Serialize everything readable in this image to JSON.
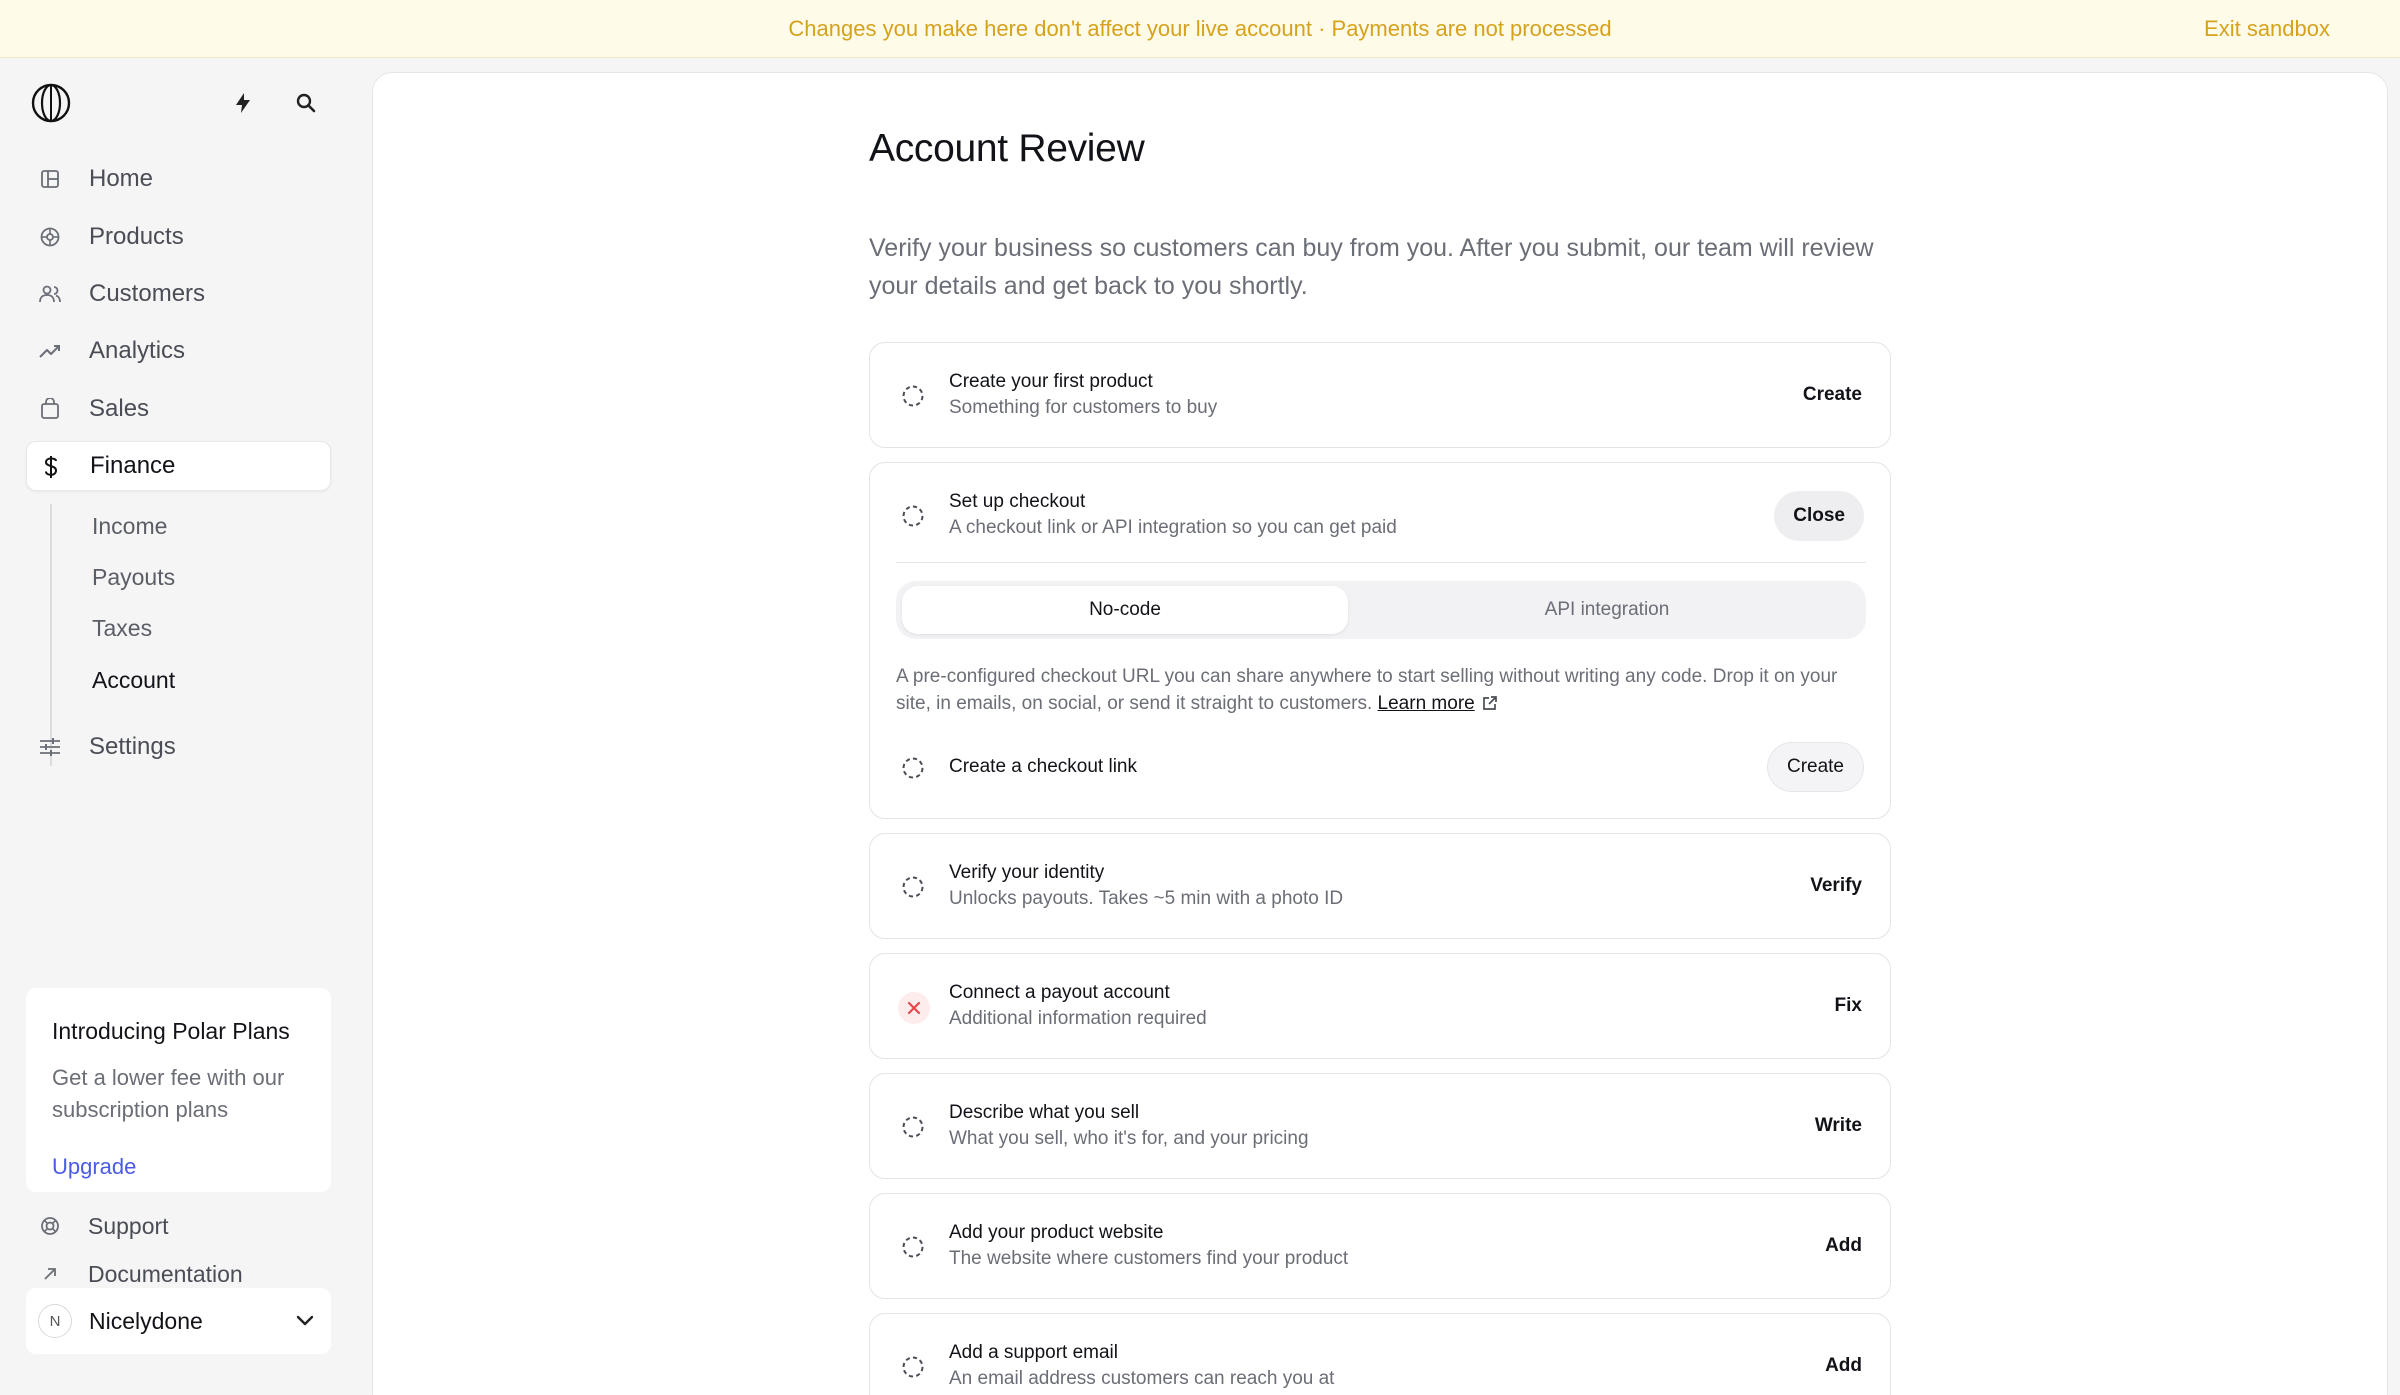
{
  "banner": {
    "text": "Changes you make here don't affect your live account · Payments are not processed",
    "exit_label": "Exit sandbox"
  },
  "sidebar": {
    "items": [
      {
        "label": "Home",
        "icon": "home-icon"
      },
      {
        "label": "Products",
        "icon": "products-icon"
      },
      {
        "label": "Customers",
        "icon": "customers-icon"
      },
      {
        "label": "Analytics",
        "icon": "analytics-icon"
      },
      {
        "label": "Sales",
        "icon": "sales-icon"
      },
      {
        "label": "Finance",
        "icon": "dollar-icon",
        "active": true
      }
    ],
    "finance_sub": [
      "Income",
      "Payouts",
      "Taxes",
      "Account"
    ],
    "finance_sub_active": "Account",
    "settings_label": "Settings",
    "promo": {
      "title": "Introducing Polar Plans",
      "text": "Get a lower fee with our subscription plans",
      "link": "Upgrade"
    },
    "support_label": "Support",
    "docs_label": "Documentation",
    "user": {
      "initial": "N",
      "name": "Nicelydone"
    }
  },
  "main": {
    "title": "Account Review",
    "description": "Verify your business so customers can buy from you. After you submit, our team will review your details and get back to you shortly.",
    "steps": [
      {
        "title": "Create your first product",
        "sub": "Something for customers to buy",
        "action": "Create",
        "status": "pending"
      },
      {
        "title": "Set up checkout",
        "sub": "A checkout link or API integration so you can get paid",
        "action": "Close",
        "status": "pending",
        "expanded": true
      },
      {
        "title": "Verify your identity",
        "sub": "Unlocks payouts. Takes ~5 min with a photo ID",
        "action": "Verify",
        "status": "pending"
      },
      {
        "title": "Connect a payout account",
        "sub": "Additional information required",
        "action": "Fix",
        "status": "error"
      },
      {
        "title": "Describe what you sell",
        "sub": "What you sell, who it's for, and your pricing",
        "action": "Write",
        "status": "pending"
      },
      {
        "title": "Add your product website",
        "sub": "The website where customers find your product",
        "action": "Add",
        "status": "pending"
      },
      {
        "title": "Add a support email",
        "sub": "An email address customers can reach you at",
        "action": "Add",
        "status": "pending"
      }
    ],
    "checkout": {
      "tabs": [
        "No-code",
        "API integration"
      ],
      "active_tab": "No-code",
      "description": "A pre-configured checkout URL you can share anywhere to start selling without writing any code. Drop it on your site, in emails, on social, or send it straight to customers.",
      "learn_more": "Learn more",
      "substep_title": "Create a checkout link",
      "substep_action": "Create"
    }
  },
  "colors": {
    "banner_bg": "#fefbe8",
    "banner_text": "#d6a21c",
    "link": "#4b5be6",
    "error": "#e5484d"
  }
}
